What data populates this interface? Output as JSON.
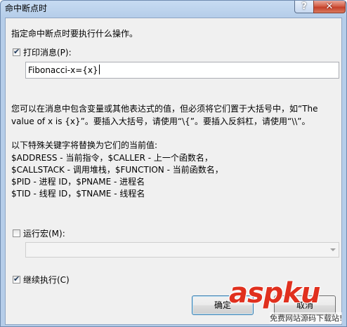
{
  "window": {
    "title": "命中断点时"
  },
  "titlebar": {
    "help_glyph": "?",
    "close_glyph": "✕"
  },
  "dialog": {
    "instruction": "指定命中断点时要执行什么操作。",
    "print_message": {
      "checked": true,
      "label": "打印消息(P):",
      "value": "Fibonacci-x={x}"
    },
    "hint_line1": "您可以在消息中包含变量或其他表达式的值，但必须将它们置于大括号中，如“The",
    "hint_line2": "value of x is {x}”。要插入大括号，请使用“\\{”。要插入反斜杠，请使用“\\\\”。",
    "keywords_title": "以下特殊关键字将替换为它们的当前值:",
    "keywords": [
      "$ADDRESS - 当前指令，$CALLER - 上一个函数名，",
      "$CALLSTACK - 调用堆栈，$FUNCTION - 当前函数名，",
      "$PID - 进程 ID，$PNAME - 进程名",
      "$TID - 线程 ID，$TNAME - 线程名"
    ],
    "run_macro": {
      "checked": false,
      "label": "运行宏(M):",
      "value": ""
    },
    "continue_execution": {
      "checked": true,
      "label": "继续执行(C)"
    },
    "ok_label": "确定",
    "cancel_label": "取消"
  },
  "watermark": {
    "brand": "aspku",
    "tagline": "免费网站源码下载站!"
  }
}
